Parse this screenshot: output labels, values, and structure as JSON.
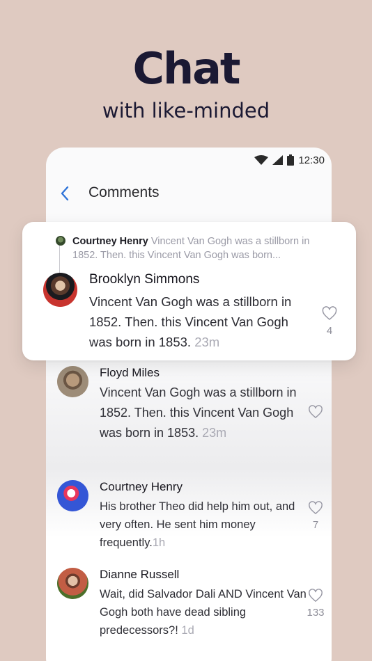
{
  "hero": {
    "title": "Chat",
    "subtitle": "with like-minded"
  },
  "status_bar": {
    "time": "12:30",
    "icons": [
      "wifi-icon",
      "signal-icon",
      "battery-icon"
    ]
  },
  "header": {
    "back_icon": "chevron-left-icon",
    "title": "Comments"
  },
  "highlighted": {
    "quote": {
      "name": "Courtney Henry",
      "text": "Vincent Van Gogh was a stillborn in 1852. Then. this Vincent Van Gogh was born..."
    },
    "name": "Brooklyn Simmons",
    "text": "Vincent Van Gogh was a stillborn in 1852. Then. this Vincent Van Gogh was born in 1853.",
    "time": "23m",
    "likes": "4"
  },
  "comments": [
    {
      "name": "Floyd Miles",
      "text": "Vincent Van Gogh was a stillborn in 1852. Then. this Vincent Van Gogh was born in 1853.",
      "time": "23m",
      "likes": ""
    },
    {
      "name": "Courtney Henry",
      "text": "His brother Theo did help him out, and very often. He sent him money frequently.",
      "time": "1h",
      "likes": "7"
    },
    {
      "name": "Dianne Russell",
      "text": "Wait, did Salvador Dali AND Vincent Van Gogh both have dead sibling predecessors?!",
      "time": "1d",
      "likes": "133"
    }
  ],
  "colors": {
    "background": "#dfcac1",
    "accent": "#2f74d8",
    "muted": "#a9a9b3"
  }
}
